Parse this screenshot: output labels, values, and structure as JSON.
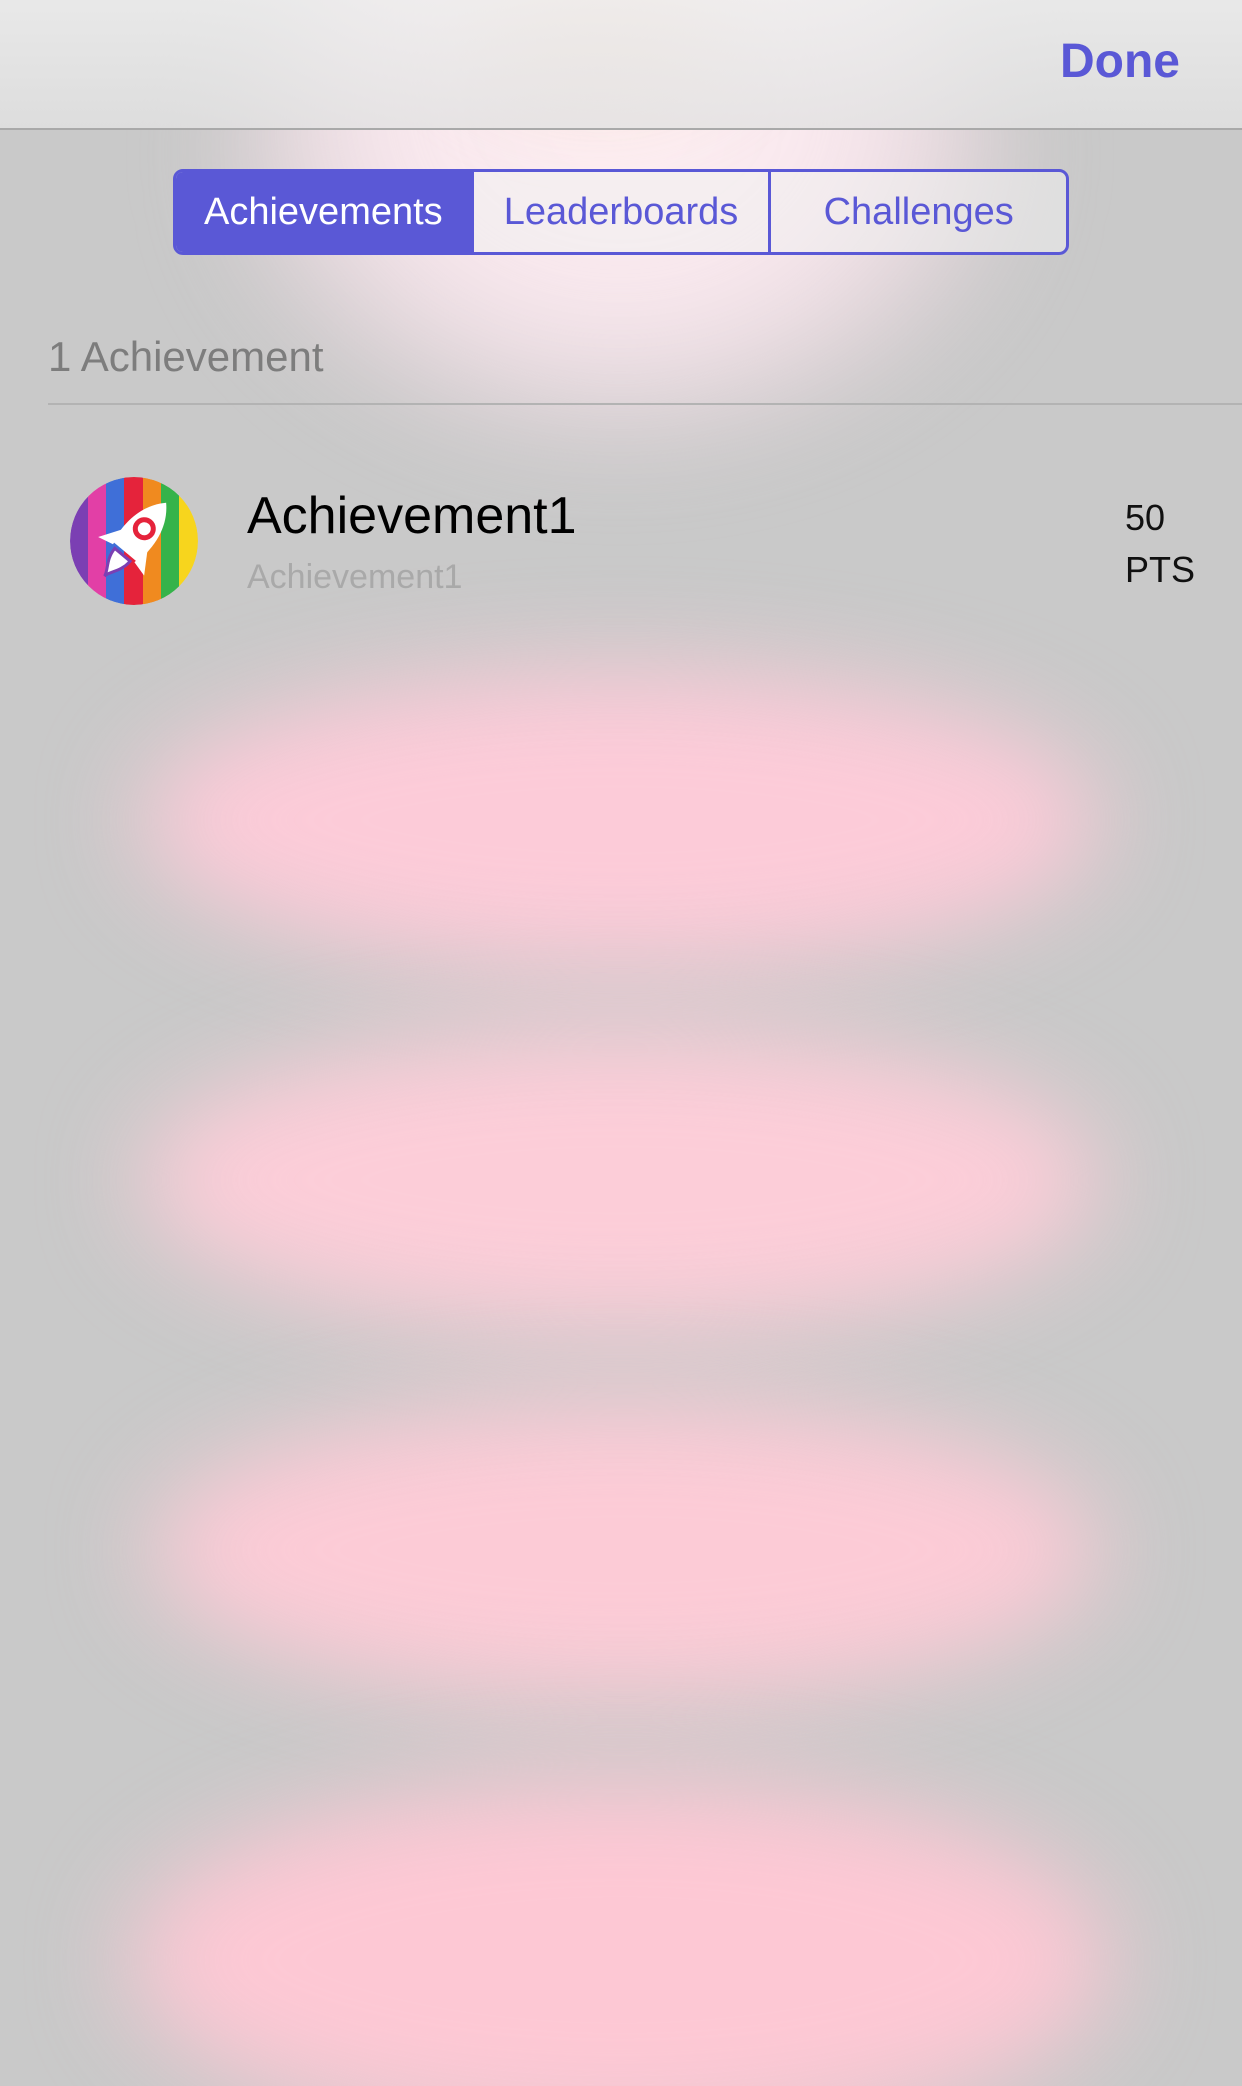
{
  "navbar": {
    "done_label": "Done"
  },
  "segmented_control": {
    "segments": [
      {
        "label": "Achievements",
        "selected": true
      },
      {
        "label": "Leaderboards",
        "selected": false
      },
      {
        "label": "Challenges",
        "selected": false
      }
    ]
  },
  "section": {
    "header": "1 Achievement"
  },
  "achievements": [
    {
      "title": "Achievement1",
      "subtitle": "Achievement1",
      "points_value": "50",
      "points_unit": "PTS",
      "icon": "rocket-icon"
    }
  ],
  "colors": {
    "accent": "#5a58d6",
    "background": "#c9c9c9",
    "header_text": "#7d7d7d",
    "subtitle_text": "#a9a9a9"
  }
}
